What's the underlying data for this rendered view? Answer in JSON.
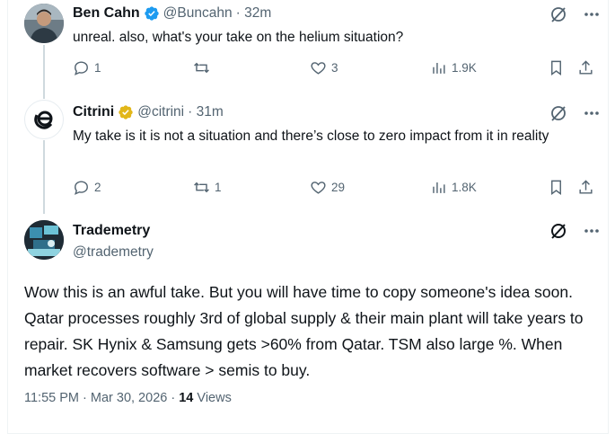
{
  "tweets": [
    {
      "display_name": "Ben Cahn",
      "handle": "@Buncahn",
      "time": "· 32m",
      "text": "unreal. also, what's your take on the helium situation?",
      "replies": "1",
      "retweets": "",
      "likes": "3",
      "views": "1.9K"
    },
    {
      "display_name": "Citrini",
      "handle": "@citrini",
      "time": "· 31m",
      "text": "My take is it is not a situation and there’s close to zero impact from it in reality",
      "replies": "2",
      "retweets": "1",
      "likes": "29",
      "views": "1.8K"
    }
  ],
  "main_tweet": {
    "display_name": "Trademetry",
    "handle": "@trademetry",
    "text": "Wow this is an awful take. But you will have time to copy someone's idea soon. Qatar processes roughly 3rd of global supply & their main plant will take years to repair. SK Hynix & Samsung gets >60% from Qatar. TSM also large %. When market recovers software > semis to buy.",
    "timestamp": "11:55 PM · Mar 30, 2026",
    "separator": "·",
    "views_count": "14",
    "views_label": "Views"
  },
  "colors": {
    "verified_blue": "#1d9bf0",
    "verified_gold": "#e2b719",
    "muted": "#536471",
    "text": "#0f1419"
  }
}
